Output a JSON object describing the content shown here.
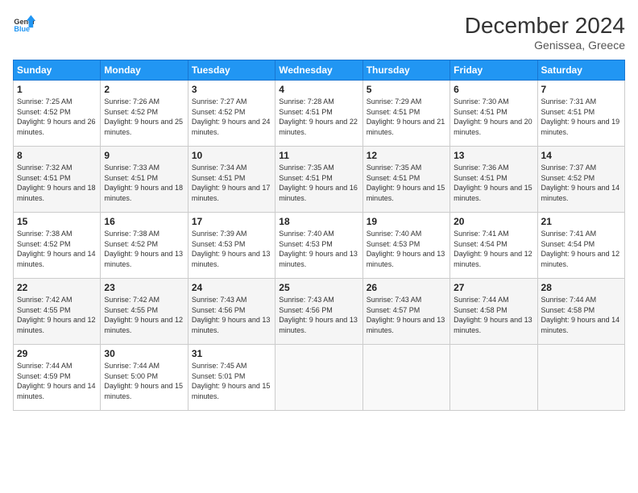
{
  "logo": {
    "line1": "General",
    "line2": "Blue"
  },
  "title": "December 2024",
  "location": "Genissea, Greece",
  "days_header": [
    "Sunday",
    "Monday",
    "Tuesday",
    "Wednesday",
    "Thursday",
    "Friday",
    "Saturday"
  ],
  "weeks": [
    [
      {
        "day": "1",
        "sunrise": "7:25 AM",
        "sunset": "4:52 PM",
        "daylight": "9 hours and 26 minutes."
      },
      {
        "day": "2",
        "sunrise": "7:26 AM",
        "sunset": "4:52 PM",
        "daylight": "9 hours and 25 minutes."
      },
      {
        "day": "3",
        "sunrise": "7:27 AM",
        "sunset": "4:52 PM",
        "daylight": "9 hours and 24 minutes."
      },
      {
        "day": "4",
        "sunrise": "7:28 AM",
        "sunset": "4:51 PM",
        "daylight": "9 hours and 22 minutes."
      },
      {
        "day": "5",
        "sunrise": "7:29 AM",
        "sunset": "4:51 PM",
        "daylight": "9 hours and 21 minutes."
      },
      {
        "day": "6",
        "sunrise": "7:30 AM",
        "sunset": "4:51 PM",
        "daylight": "9 hours and 20 minutes."
      },
      {
        "day": "7",
        "sunrise": "7:31 AM",
        "sunset": "4:51 PM",
        "daylight": "9 hours and 19 minutes."
      }
    ],
    [
      {
        "day": "8",
        "sunrise": "7:32 AM",
        "sunset": "4:51 PM",
        "daylight": "9 hours and 18 minutes."
      },
      {
        "day": "9",
        "sunrise": "7:33 AM",
        "sunset": "4:51 PM",
        "daylight": "9 hours and 18 minutes."
      },
      {
        "day": "10",
        "sunrise": "7:34 AM",
        "sunset": "4:51 PM",
        "daylight": "9 hours and 17 minutes."
      },
      {
        "day": "11",
        "sunrise": "7:35 AM",
        "sunset": "4:51 PM",
        "daylight": "9 hours and 16 minutes."
      },
      {
        "day": "12",
        "sunrise": "7:35 AM",
        "sunset": "4:51 PM",
        "daylight": "9 hours and 15 minutes."
      },
      {
        "day": "13",
        "sunrise": "7:36 AM",
        "sunset": "4:51 PM",
        "daylight": "9 hours and 15 minutes."
      },
      {
        "day": "14",
        "sunrise": "7:37 AM",
        "sunset": "4:52 PM",
        "daylight": "9 hours and 14 minutes."
      }
    ],
    [
      {
        "day": "15",
        "sunrise": "7:38 AM",
        "sunset": "4:52 PM",
        "daylight": "9 hours and 14 minutes."
      },
      {
        "day": "16",
        "sunrise": "7:38 AM",
        "sunset": "4:52 PM",
        "daylight": "9 hours and 13 minutes."
      },
      {
        "day": "17",
        "sunrise": "7:39 AM",
        "sunset": "4:53 PM",
        "daylight": "9 hours and 13 minutes."
      },
      {
        "day": "18",
        "sunrise": "7:40 AM",
        "sunset": "4:53 PM",
        "daylight": "9 hours and 13 minutes."
      },
      {
        "day": "19",
        "sunrise": "7:40 AM",
        "sunset": "4:53 PM",
        "daylight": "9 hours and 13 minutes."
      },
      {
        "day": "20",
        "sunrise": "7:41 AM",
        "sunset": "4:54 PM",
        "daylight": "9 hours and 12 minutes."
      },
      {
        "day": "21",
        "sunrise": "7:41 AM",
        "sunset": "4:54 PM",
        "daylight": "9 hours and 12 minutes."
      }
    ],
    [
      {
        "day": "22",
        "sunrise": "7:42 AM",
        "sunset": "4:55 PM",
        "daylight": "9 hours and 12 minutes."
      },
      {
        "day": "23",
        "sunrise": "7:42 AM",
        "sunset": "4:55 PM",
        "daylight": "9 hours and 12 minutes."
      },
      {
        "day": "24",
        "sunrise": "7:43 AM",
        "sunset": "4:56 PM",
        "daylight": "9 hours and 13 minutes."
      },
      {
        "day": "25",
        "sunrise": "7:43 AM",
        "sunset": "4:56 PM",
        "daylight": "9 hours and 13 minutes."
      },
      {
        "day": "26",
        "sunrise": "7:43 AM",
        "sunset": "4:57 PM",
        "daylight": "9 hours and 13 minutes."
      },
      {
        "day": "27",
        "sunrise": "7:44 AM",
        "sunset": "4:58 PM",
        "daylight": "9 hours and 13 minutes."
      },
      {
        "day": "28",
        "sunrise": "7:44 AM",
        "sunset": "4:58 PM",
        "daylight": "9 hours and 14 minutes."
      }
    ],
    [
      {
        "day": "29",
        "sunrise": "7:44 AM",
        "sunset": "4:59 PM",
        "daylight": "9 hours and 14 minutes."
      },
      {
        "day": "30",
        "sunrise": "7:44 AM",
        "sunset": "5:00 PM",
        "daylight": "9 hours and 15 minutes."
      },
      {
        "day": "31",
        "sunrise": "7:45 AM",
        "sunset": "5:01 PM",
        "daylight": "9 hours and 15 minutes."
      },
      null,
      null,
      null,
      null
    ]
  ]
}
